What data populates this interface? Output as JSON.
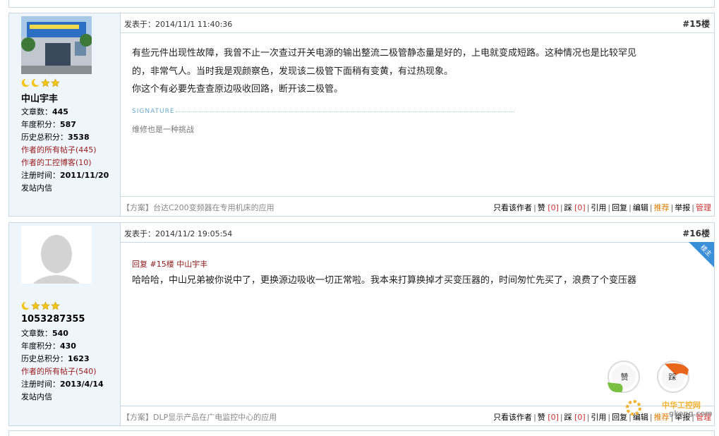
{
  "posts": [
    {
      "author": {
        "name": "中山宇丰",
        "stats": [
          {
            "label": "文章数：",
            "value": "445"
          },
          {
            "label": "年度积分：",
            "value": "587"
          },
          {
            "label": "历史总积分：",
            "value": "3538"
          }
        ],
        "links": [
          "作者的所有帖子(445)",
          "作者的工控博客(10)"
        ],
        "reg_label": "注册时间：",
        "reg_date": "2011/11/20",
        "message": "发站内信"
      },
      "time": "发表于：2014/11/1 11:40:36",
      "floor": "#15楼",
      "content": [
        "有些元件出现性故障，我曾不止一次查过开关电源的输出整流二极管静态量是好的，上电就变成短路。这种情况也是比较罕见",
        "的，非常气人。当时我是观颜察色，发现该二极管下面稍有变黄，有过热现象。",
        "你这个有必要先查查原边吸收回路，断开该二极管。"
      ],
      "signature_label": "SIGNATURE",
      "signature": "维修也是一种挑战",
      "plan": "【方案】台达C200变频器在专用机床的应用"
    },
    {
      "author": {
        "name": "1053287355",
        "stats": [
          {
            "label": "文章数：",
            "value": "540"
          },
          {
            "label": "年度积分：",
            "value": "430"
          },
          {
            "label": "历史总积分：",
            "value": "1623"
          }
        ],
        "links": [
          "作者的所有帖子(540)"
        ],
        "reg_label": "注册时间：",
        "reg_date": "2013/4/14",
        "message": "发站内信"
      },
      "time": "发表于：2014/11/2 19:05:54",
      "floor": "#16楼",
      "reply_to": "回复 #15楼 中山宇丰",
      "content": [
        "哈哈哈，中山兄弟被你说中了，更换源边吸收一切正常啦。我本来打算换掉才买变压器的，时间匆忙先买了，浪费了个变压器"
      ],
      "badge": "楼主",
      "plan": "【方案】DLP显示产品在广电监控中心的应用"
    }
  ],
  "actions": {
    "only_author": "只看该作者",
    "like": "赞",
    "like_count": "[0]",
    "dislike": "踩",
    "dislike_count": "[0]",
    "quote": "引用",
    "reply": "回复",
    "edit": "编辑",
    "recommend": "推荐",
    "report": "举报",
    "manage": "管理"
  },
  "float_buttons": {
    "like": "赞",
    "dislike": "踩"
  },
  "watermark": {
    "brand": "中华工控网",
    "url": "gkong.com"
  },
  "colors": {
    "border": "#c8d8e6",
    "sidebar": "#eef5fb",
    "red": "#9b1b1b",
    "orange": "#e07b00"
  }
}
